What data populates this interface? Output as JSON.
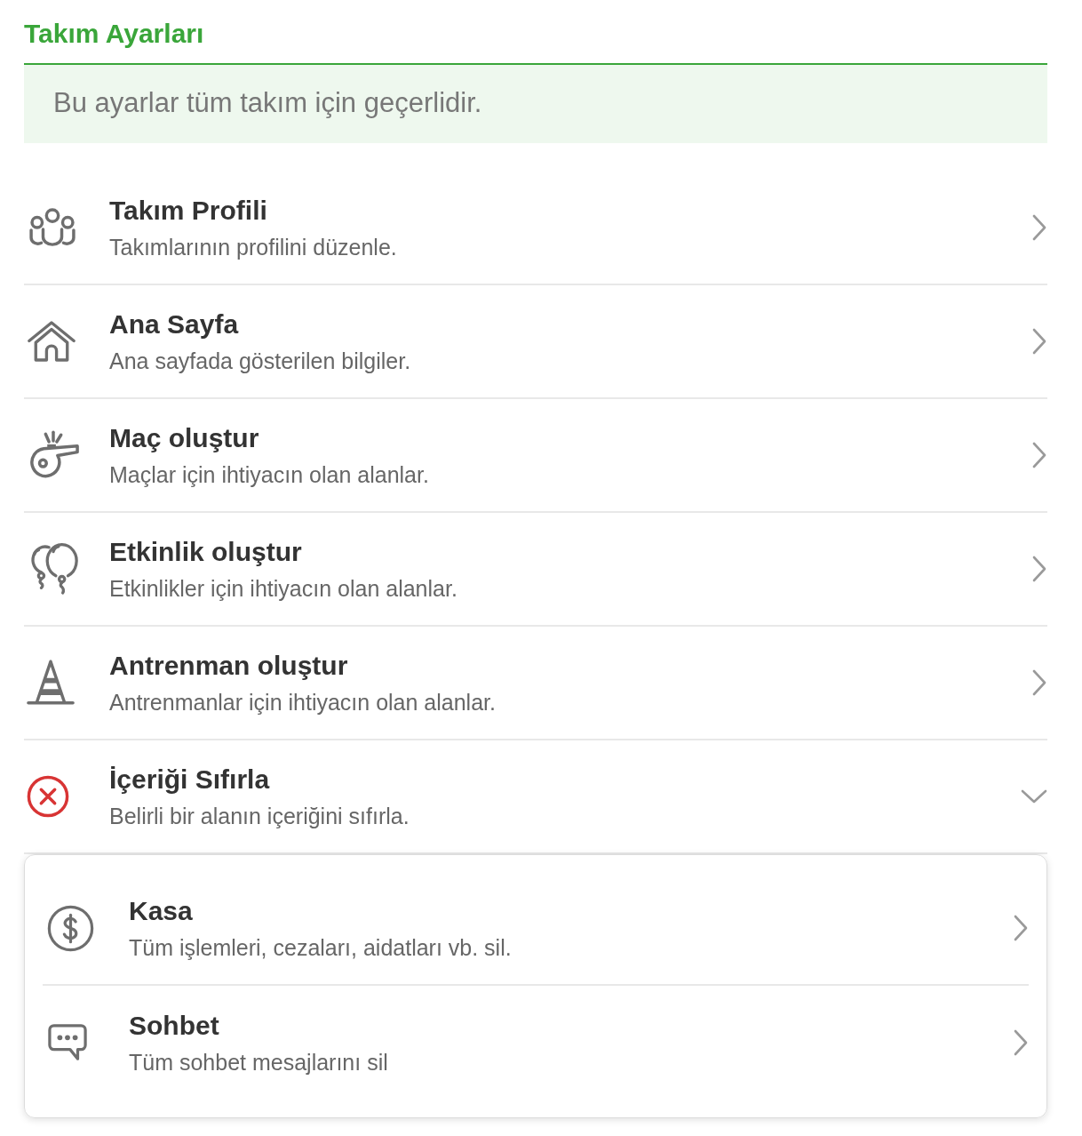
{
  "header": {
    "title": "Takım Ayarları",
    "info": "Bu ayarlar tüm takım için geçerlidir."
  },
  "items": [
    {
      "kind": "team",
      "title": "Takım Profili",
      "subtitle": "Takımlarının profilini düzenle.",
      "expanded": false
    },
    {
      "kind": "home",
      "title": "Ana Sayfa",
      "subtitle": "Ana sayfada gösterilen bilgiler.",
      "expanded": false
    },
    {
      "kind": "match",
      "title": "Maç oluştur",
      "subtitle": "Maçlar için ihtiyacın olan alanlar.",
      "expanded": false
    },
    {
      "kind": "event",
      "title": "Etkinlik oluştur",
      "subtitle": "Etkinlikler için ihtiyacın olan alanlar.",
      "expanded": false
    },
    {
      "kind": "training",
      "title": "Antrenman oluştur",
      "subtitle": "Antrenmanlar için ihtiyacın olan alanlar.",
      "expanded": false
    },
    {
      "kind": "reset",
      "title": "İçeriği Sıfırla",
      "subtitle": "Belirli bir alanın içeriğini sıfırla.",
      "expanded": true,
      "children": [
        {
          "kind": "cash",
          "title": "Kasa",
          "subtitle": "Tüm işlemleri, cezaları, aidatları vb. sil.",
          "expanded": false
        },
        {
          "kind": "chat",
          "title": "Sohbet",
          "subtitle": "Tüm sohbet mesajlarını sil",
          "expanded": false
        }
      ]
    }
  ]
}
